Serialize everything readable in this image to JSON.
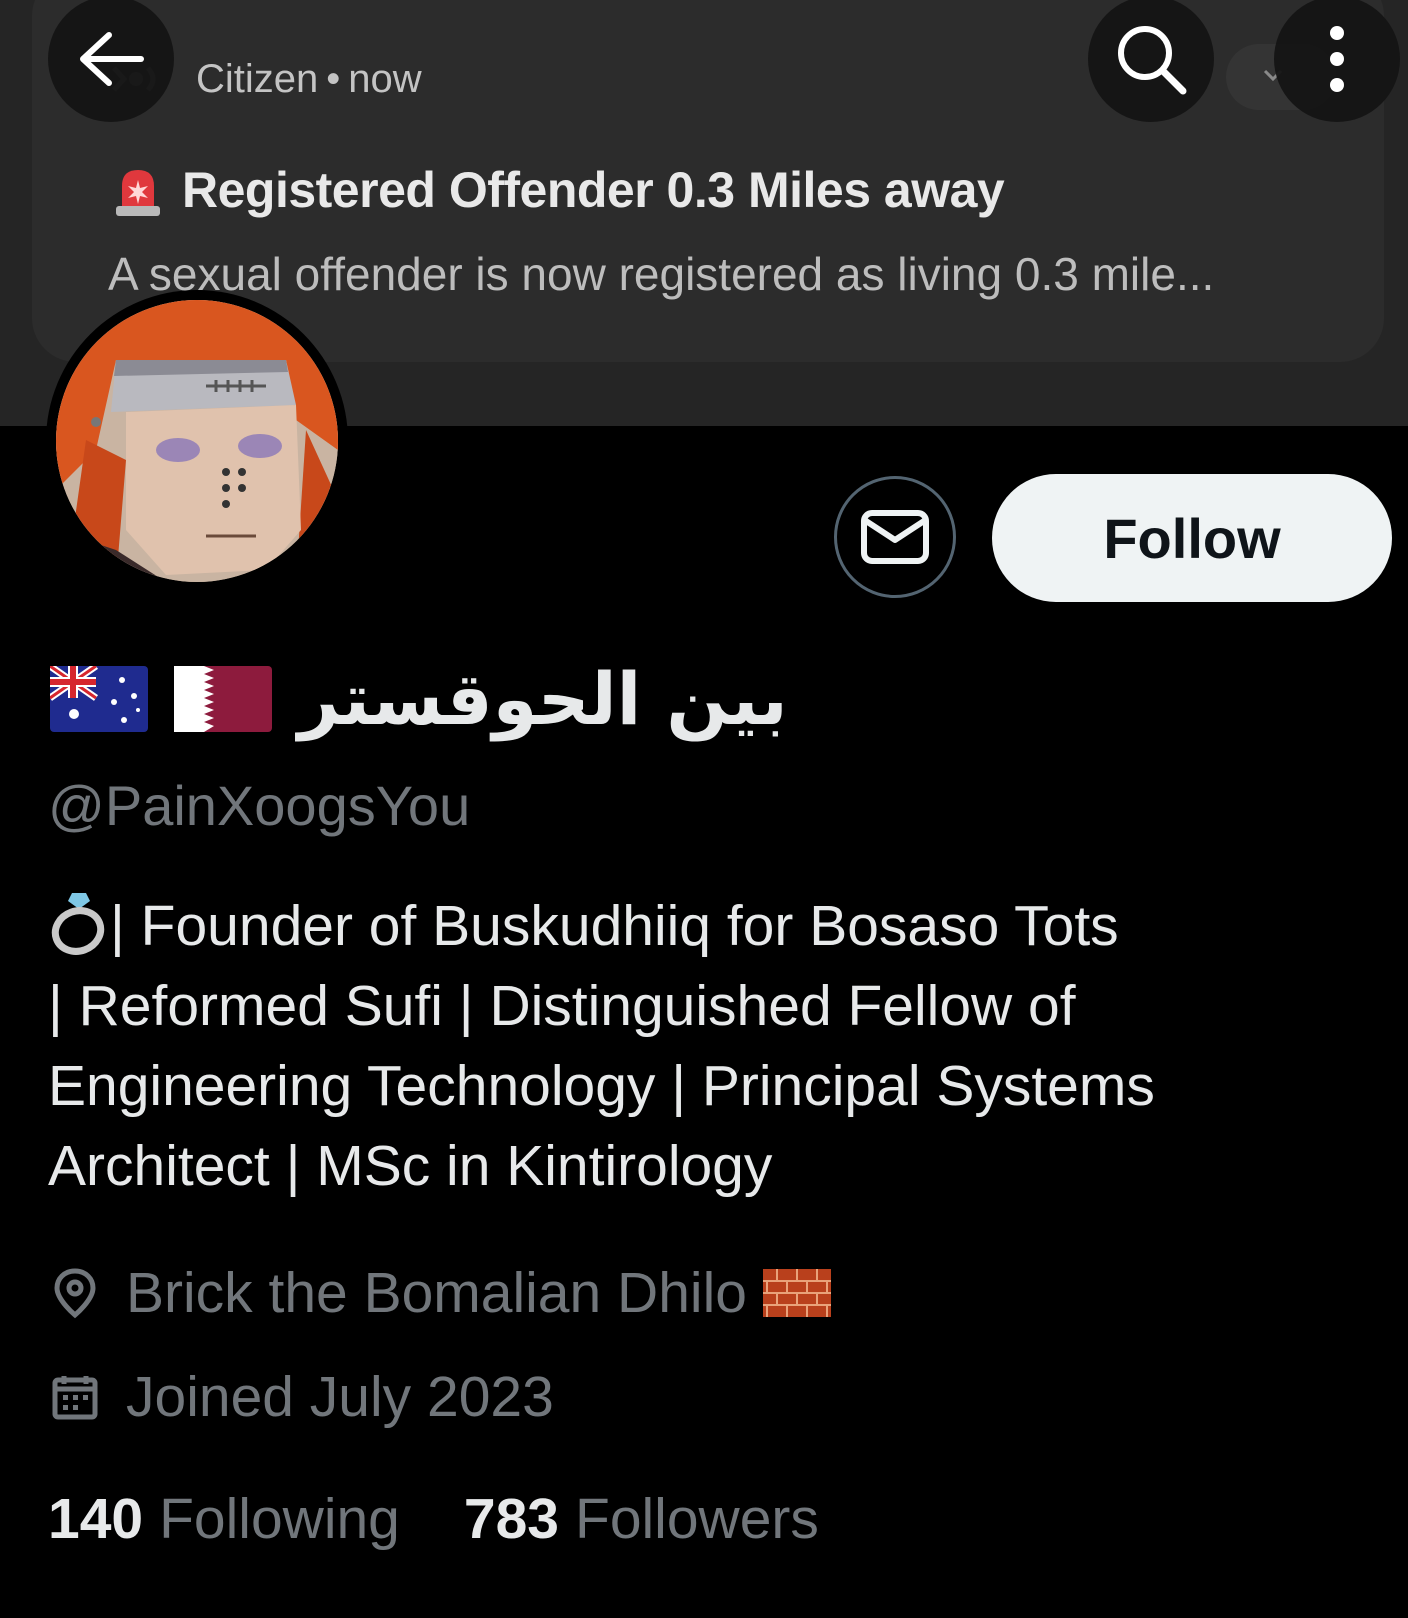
{
  "notification": {
    "app_icon": "citizen-app-icon",
    "source": "Citizen",
    "separator": "•",
    "time": "now",
    "alert_icon": "siren-icon",
    "title": "Registered Offender 0.3 Miles away",
    "body": "A sexual offender is now registered as living 0.3 mile..."
  },
  "top_bar": {
    "back_icon": "arrow-left-icon",
    "search_icon": "search-icon",
    "more_icon": "more-vertical-icon"
  },
  "profile": {
    "display_name": "بين الحوقستر",
    "flags": [
      "australia-flag",
      "qatar-flag"
    ],
    "handle": "@PainXoogsYou",
    "bio_line_1": "| Founder of Buskudhiiq for Bosaso Tots",
    "bio_line_2": "| Reformed Sufi | Distinguished Fellow of",
    "bio_line_3": "Engineering Technology | Principal Systems",
    "bio_line_4": "Architect | MSc in Kintirology",
    "bio_icon": "ring-icon",
    "location": "Brick the Bomalian Dhilo",
    "location_icon": "location-pin-icon",
    "location_emoji": "brick-icon",
    "joined": "Joined July 2023",
    "joined_icon": "calendar-icon",
    "following_count": "140",
    "following_label": "Following",
    "followers_count": "783",
    "followers_label": "Followers"
  },
  "actions": {
    "follow_label": "Follow",
    "message_icon": "envelope-icon"
  },
  "colors": {
    "background": "#000000",
    "primary_text": "#e7e9ea",
    "secondary_text": "#71767b",
    "follow_button_bg": "#eff3f4",
    "follow_button_text": "#0f1419",
    "banner_bg": "#252525"
  }
}
